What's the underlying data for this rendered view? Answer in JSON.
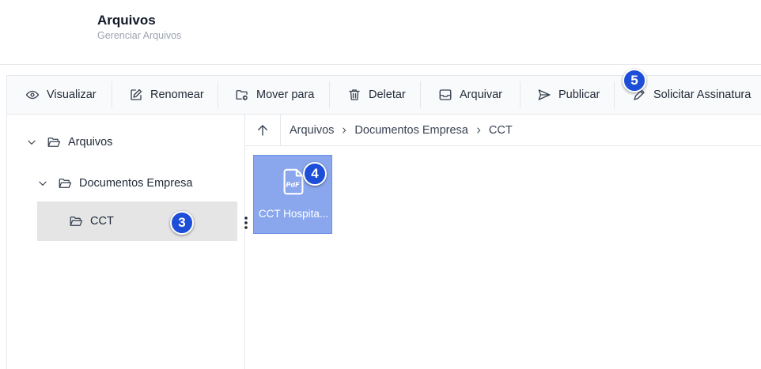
{
  "header": {
    "title": "Arquivos",
    "subtitle": "Gerenciar Arquivos"
  },
  "toolbar": {
    "items": [
      {
        "label": "Visualizar",
        "icon": "eye-icon"
      },
      {
        "label": "Renomear",
        "icon": "edit-icon"
      },
      {
        "label": "Mover para",
        "icon": "folder-move-icon"
      },
      {
        "label": "Deletar",
        "icon": "trash-icon"
      },
      {
        "label": "Arquivar",
        "icon": "archive-icon"
      },
      {
        "label": "Publicar",
        "icon": "send-icon"
      },
      {
        "label": "Solicitar Assinatura",
        "icon": "pen-icon"
      }
    ]
  },
  "tree": {
    "items": [
      {
        "label": "Arquivos",
        "expanded": true
      },
      {
        "label": "Documentos Empresa",
        "expanded": true
      },
      {
        "label": "CCT",
        "selected": true
      }
    ]
  },
  "breadcrumb": {
    "items": [
      "Arquivos",
      "Documentos Empresa",
      "CCT"
    ]
  },
  "files": [
    {
      "name": "CCT Hospita...",
      "type": "PdF"
    }
  ],
  "badges": {
    "tree_item": "3",
    "file": "4",
    "toolbar": "5"
  },
  "colors": {
    "accent_badge": "#1d4ed8",
    "selected_tile": "#8aa7ee",
    "selected_tree": "#e5e5e5"
  }
}
